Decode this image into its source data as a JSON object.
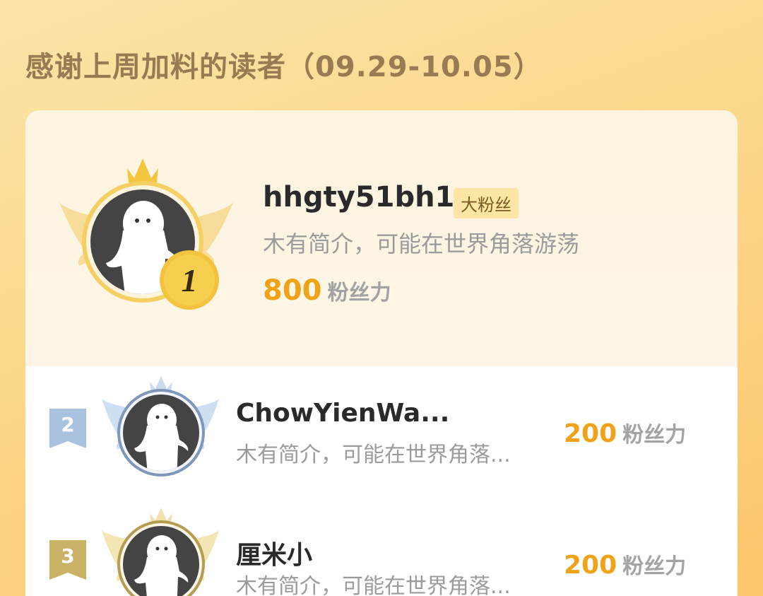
{
  "header": {
    "title": "感谢上周加料的读者（09.29-10.05）"
  },
  "top_fan": {
    "rank": "1",
    "name": "hhgty51bh1",
    "badge": "大粉丝",
    "bio": "木有简介，可能在世界角落游荡",
    "score": "800",
    "score_unit": "粉丝力"
  },
  "fans": [
    {
      "rank": "2",
      "name": "ChowYienWa...",
      "bio": "木有简介，可能在世界角落...",
      "score": "200",
      "score_unit": "粉丝力"
    },
    {
      "rank": "3",
      "name": "厘米小",
      "bio": "木有简介，可能在世界角落...",
      "score": "200",
      "score_unit": "粉丝力"
    }
  ],
  "colors": {
    "score": "#f0a318",
    "gold": "#f2c048",
    "silver": "#a8c2e0",
    "bronze": "#c9b266"
  },
  "icons": [
    "crown-icon",
    "wings-icon",
    "default-avatar-icon",
    "rank-medal-icon",
    "rank-ribbon-icon"
  ]
}
